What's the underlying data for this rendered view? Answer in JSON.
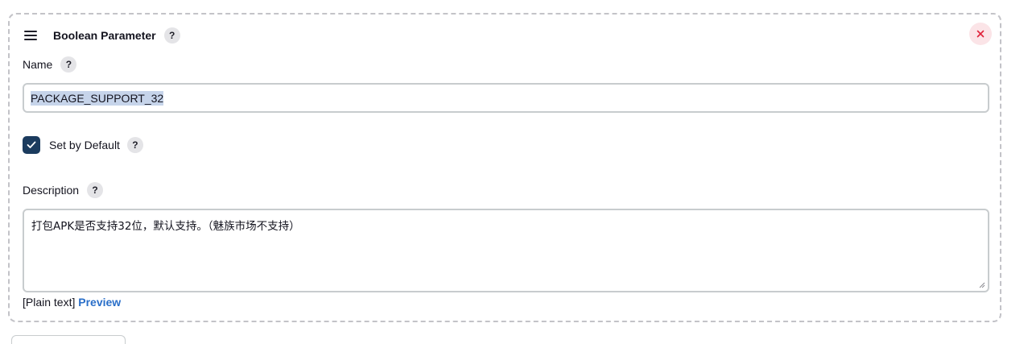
{
  "card": {
    "title": "Boolean Parameter",
    "help_label": "?"
  },
  "name_field": {
    "label": "Name",
    "help_label": "?",
    "value": "PACKAGE_SUPPORT_32"
  },
  "default_checkbox": {
    "label": "Set by Default",
    "help_label": "?",
    "checked": true
  },
  "description_field": {
    "label": "Description",
    "help_label": "?",
    "value": "打包APK是否支持32位，默认支持。（魅族市场不支持）"
  },
  "footer": {
    "format_label": "[Plain text]",
    "preview_link": "Preview"
  },
  "icons": {
    "drag": "drag-handle-icon",
    "close": "close-icon",
    "check": "check-icon"
  },
  "colors": {
    "checkbox_fill": "#1b3b5e",
    "close_icon": "#e0233a",
    "link": "#2a6fc9"
  }
}
